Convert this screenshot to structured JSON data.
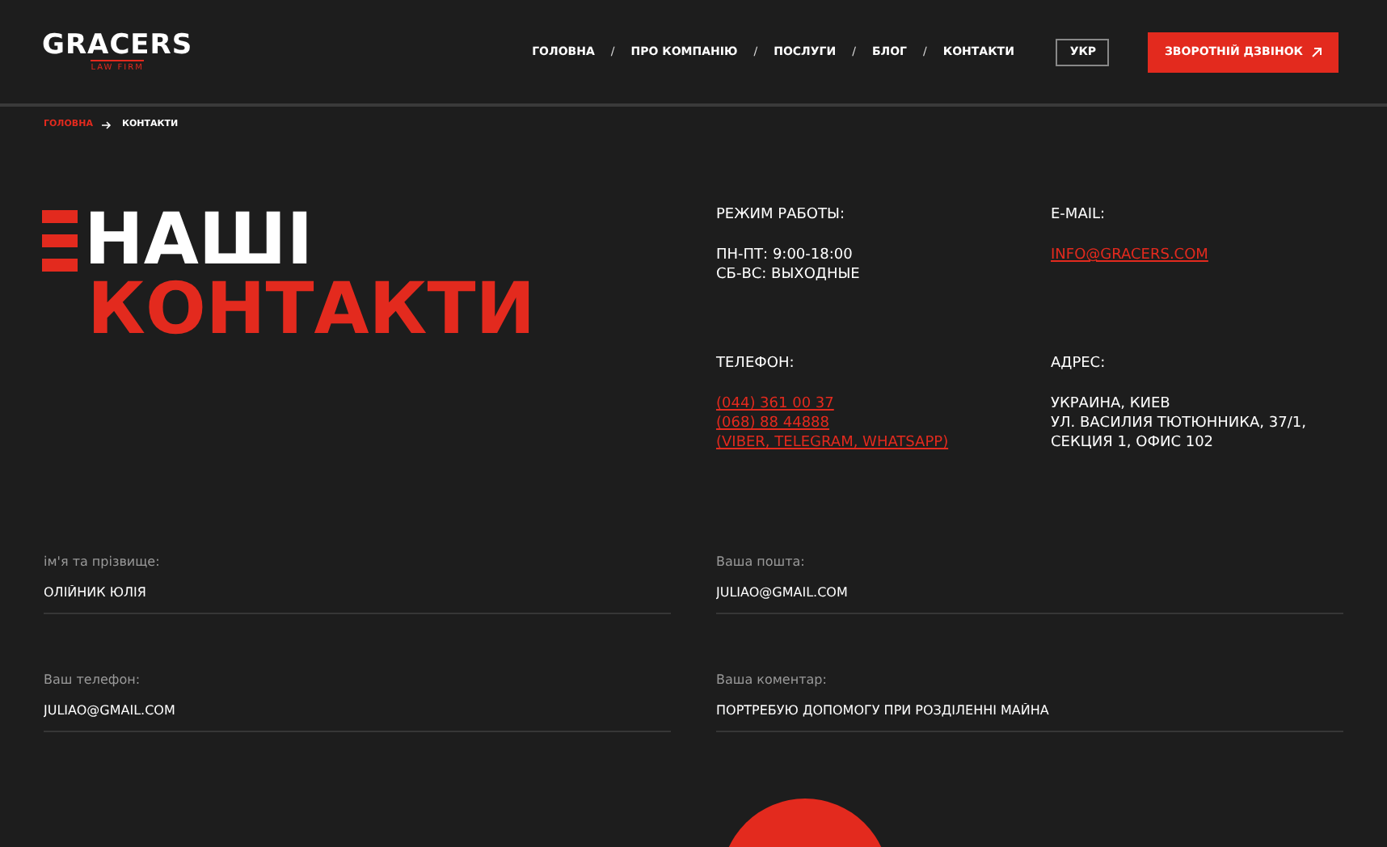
{
  "logo": {
    "name": "GRACERS",
    "tagline": "LAW FIRM"
  },
  "nav": [
    "ГОЛОВНА",
    "ПРО КОМПАНІЮ",
    "ПОСЛУГИ",
    "БЛОГ",
    "КОНТАКТИ"
  ],
  "nav_separator": "/",
  "language": "УКР",
  "callback_button": "ЗВОРОТНІЙ ДЗВІНОК",
  "breadcrumb": [
    "ГОЛОВНА",
    "КОНТАКТИ"
  ],
  "heading": {
    "line_1": "НАШІ",
    "line_2": "КОНТАКТИ"
  },
  "info": [
    {
      "title": "РЕЖИМ РАБОТЫ:",
      "lines": [
        {
          "kind": "text",
          "text": "ПН-ПТ: 9:00-18:00"
        },
        {
          "kind": "text",
          "text": "СБ-ВС: ВЫХОДНЫЕ"
        }
      ]
    },
    {
      "title": "E-MAIL:",
      "lines": [
        {
          "kind": "link",
          "text": "INFO@GRACERS.COM"
        }
      ]
    },
    {
      "title": "ТЕЛЕФОН:",
      "lines": [
        {
          "kind": "link",
          "text": "(044) 361 00 37"
        },
        {
          "kind": "link",
          "text": "(068) 88 44888"
        },
        {
          "kind": "link",
          "text": "(VIBER, TELEGRAM, WHATSAPP)"
        }
      ]
    },
    {
      "title": "АДРЕС:",
      "lines": [
        {
          "kind": "text",
          "text": "УКРАИНА, КИЕВ"
        },
        {
          "kind": "text",
          "text": "УЛ. ВАСИЛИЯ ТЮТЮННИКА, 37/1,"
        },
        {
          "kind": "text",
          "text": "СЕКЦИЯ 1, ОФИС 102"
        }
      ]
    }
  ],
  "form": [
    {
      "label": "ім'я та прізвище:",
      "value": "ОЛІЙНИК ЮЛІЯ"
    },
    {
      "label": "Ваша пошта:",
      "value": "JULIAO@GMAIL.COM"
    },
    {
      "label": "Ваш телефон:",
      "value": "JULIAO@GMAIL.COM"
    },
    {
      "label": "Ваша коментар:",
      "value": "ПОРТРЕБУЮ ДОПОМОГУ ПРИ РОЗДІЛЕННІ МАЙНА"
    }
  ]
}
